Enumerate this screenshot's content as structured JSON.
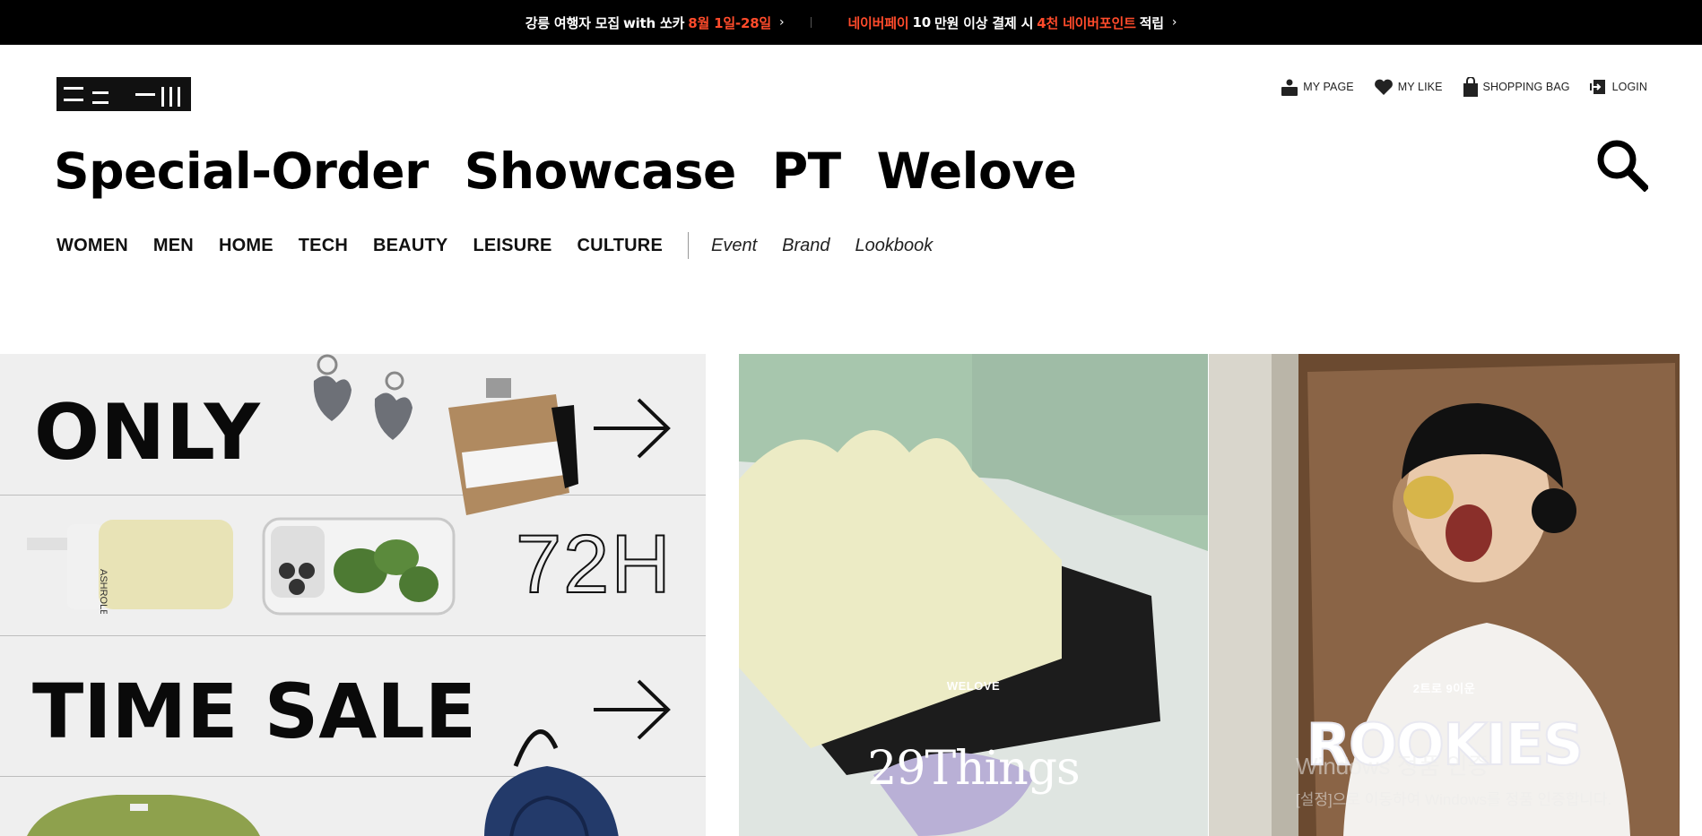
{
  "topbar": {
    "promo1": {
      "text_a": "강릉 여행자 모집 ",
      "text_b": "with 쏘카 ",
      "highlight": "8월 1일-28일",
      "chevron": "›"
    },
    "promo2": {
      "brand": "네이버페이 ",
      "amount": "10",
      "text_a": "만원 이상 결제 시 ",
      "highlight": "4천 네이버포인트",
      "text_b": " 적립",
      "chevron": "›"
    }
  },
  "utility": {
    "my_page": "MY PAGE",
    "my_like": "MY LIKE",
    "shopping_bag": "SHOPPING BAG",
    "login": "LOGIN"
  },
  "big_nav": [
    "Special-Order",
    "Showcase",
    "PT",
    "Welove"
  ],
  "categories": [
    "WOMEN",
    "MEN",
    "HOME",
    "TECH",
    "BEAUTY",
    "LEISURE",
    "CULTURE"
  ],
  "sub_links": [
    "Event",
    "Brand",
    "Lookbook"
  ],
  "banners": {
    "timesale": {
      "only": "ONLY",
      "hours": "72H",
      "time_sale": "TIME SALE",
      "arrow": "→",
      "product_brand": "ASHROLEN"
    },
    "welove": {
      "label": "WELOVE",
      "title": "29Things"
    },
    "rookies": {
      "label": "2트로 9이운",
      "title": "ROOKIES",
      "watermark_line1": "Windows 정품 인증",
      "watermark_line2": "[설정]으로 이동하여 Windows를 정품 인증합니다."
    }
  },
  "colors": {
    "accent": "#ff4b2b",
    "topbar_bg": "#000000"
  },
  "icons": [
    "user-icon",
    "heart-icon",
    "bag-icon",
    "login-icon",
    "search-icon",
    "arrow-right-icon"
  ]
}
